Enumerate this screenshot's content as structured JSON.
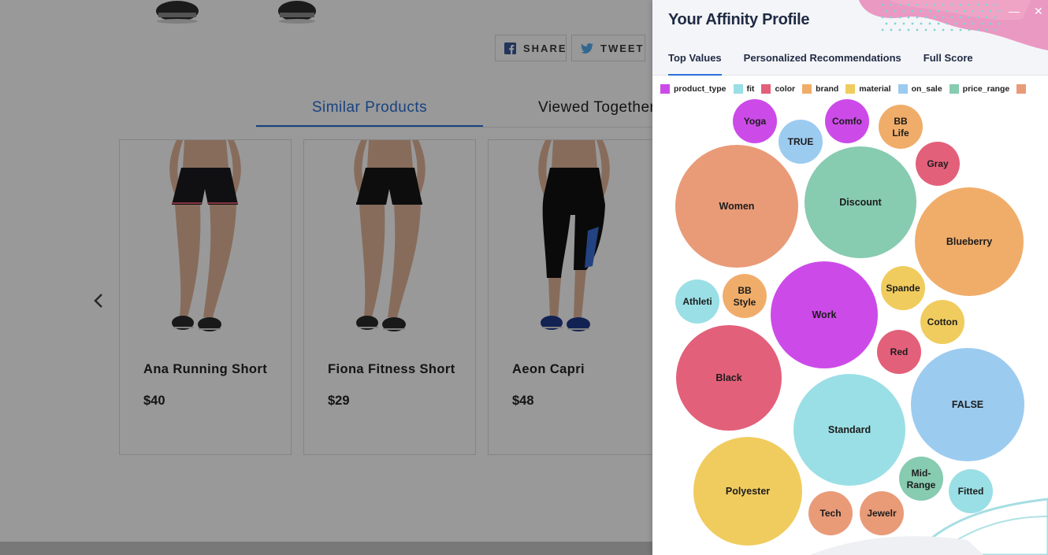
{
  "store": {
    "share": {
      "label": "SHARE"
    },
    "tweet": {
      "label": "TWEET"
    },
    "tabs": [
      {
        "label": "Similar Products",
        "active": true
      },
      {
        "label": "Viewed Together",
        "active": false
      }
    ],
    "products": [
      {
        "name": "Ana Running Short",
        "price": "$40",
        "bottom": "#1c1c1e",
        "legs": "shorts",
        "trim": "#e05a6a",
        "shoe": "#2b2b2b"
      },
      {
        "name": "Fiona Fitness Short",
        "price": "$29",
        "bottom": "#161616",
        "legs": "shorts",
        "trim": "#161616",
        "shoe": "#2b2b2b"
      },
      {
        "name": "Aeon Capri",
        "price": "$48",
        "bottom": "#121212",
        "legs": "capri",
        "trim": "#3b6fd8",
        "shoe": "#1f3a8a"
      }
    ]
  },
  "panel": {
    "title": "Your Affinity Profile",
    "minimize_icon": "—",
    "close_icon": "✕",
    "tabs": [
      {
        "label": "Top Values",
        "active": true
      },
      {
        "label": "Personalized Recommendations",
        "active": false
      },
      {
        "label": "Full Score",
        "active": false
      }
    ]
  },
  "chart_data": {
    "type": "bubble",
    "legend": [
      {
        "name": "product_type",
        "color": "#cc4be8"
      },
      {
        "name": "fit",
        "color": "#9adfe5"
      },
      {
        "name": "color",
        "color": "#e3607a"
      },
      {
        "name": "brand",
        "color": "#f0ad6a"
      },
      {
        "name": "material",
        "color": "#f0cc5e"
      },
      {
        "name": "on_sale",
        "color": "#9ccbf0"
      },
      {
        "name": "price_range",
        "color": "#87cbb0"
      },
      {
        "name": "",
        "color": "#e99b78"
      }
    ],
    "bubbles": [
      {
        "label": "Yoga",
        "category": "product_type"
      },
      {
        "label": "TRUE",
        "category": "on_sale"
      },
      {
        "label": "Comfo",
        "category": "product_type"
      },
      {
        "label": "BB Life",
        "category": "brand"
      },
      {
        "label": "Gray",
        "category": "color"
      },
      {
        "label": "Women",
        "category": ""
      },
      {
        "label": "Discount",
        "category": "price_range"
      },
      {
        "label": "Blueberry",
        "category": "brand"
      },
      {
        "label": "Athleti",
        "category": "fit"
      },
      {
        "label": "BB Style",
        "category": "brand"
      },
      {
        "label": "Work",
        "category": "product_type"
      },
      {
        "label": "Spande",
        "category": "material"
      },
      {
        "label": "Cotton",
        "category": "material"
      },
      {
        "label": "Red",
        "category": "color"
      },
      {
        "label": "Black",
        "category": "color"
      },
      {
        "label": "FALSE",
        "category": "on_sale"
      },
      {
        "label": "Standard",
        "category": "fit"
      },
      {
        "label": "Polyester",
        "category": "material"
      },
      {
        "label": "Mid-Range",
        "category": "price_range"
      },
      {
        "label": "Fitted",
        "category": "fit"
      },
      {
        "label": "Tech",
        "category": ""
      },
      {
        "label": "Jewelr",
        "category": ""
      }
    ]
  }
}
